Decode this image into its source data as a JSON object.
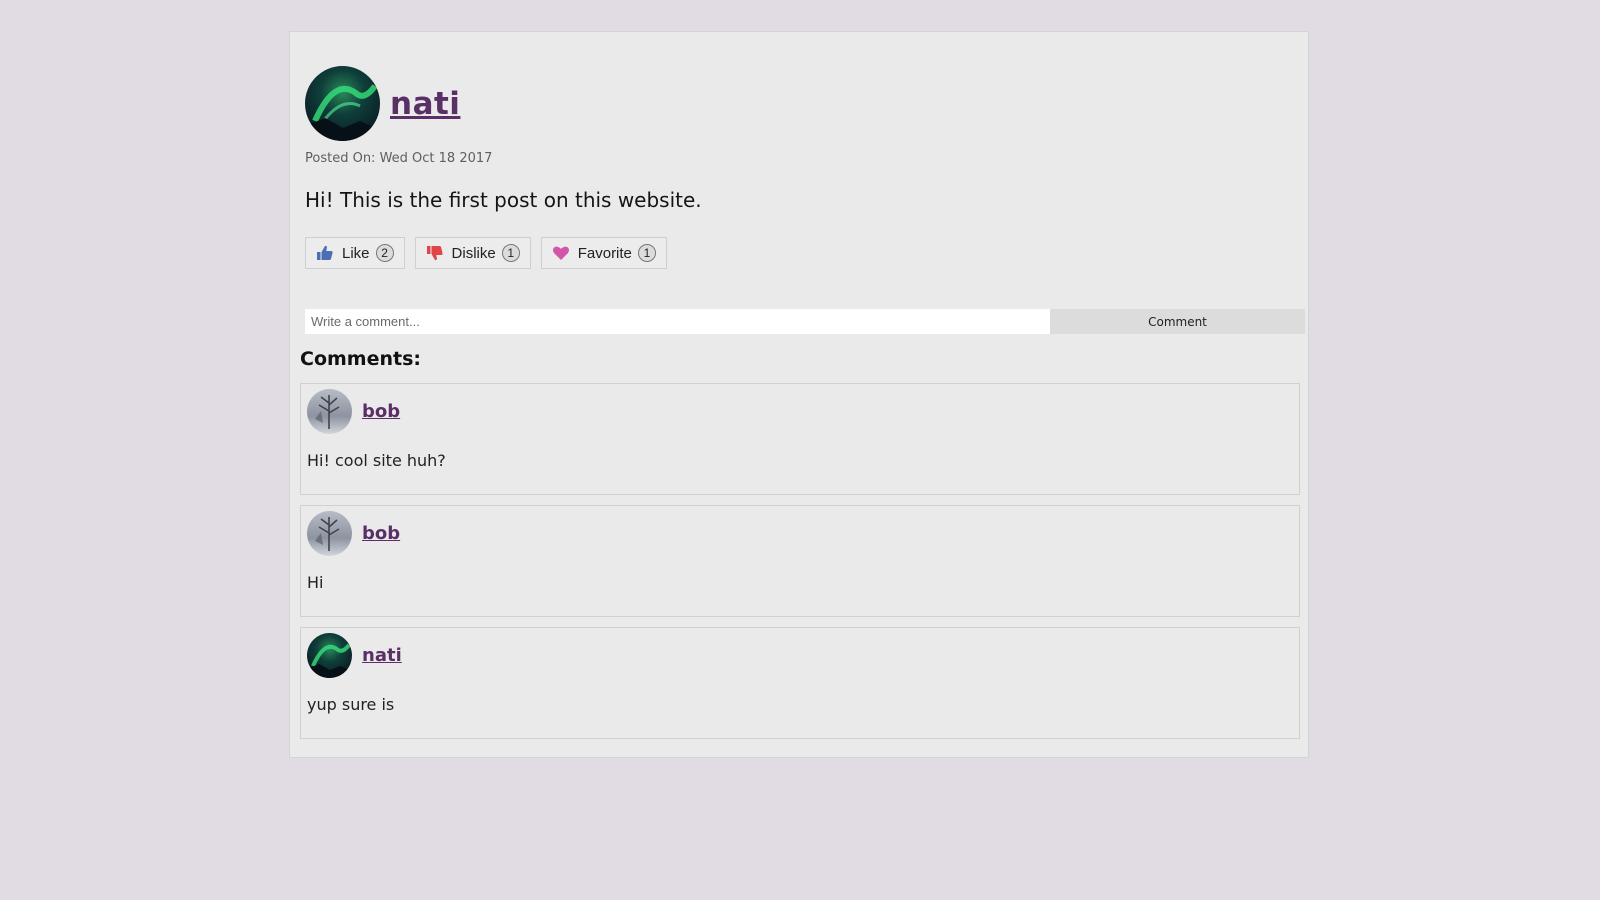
{
  "post": {
    "author": "nati",
    "posted_on": "Posted On: Wed Oct 18 2017",
    "body": "Hi! This is the first post on this website.",
    "reactions": [
      {
        "label": "Like",
        "count": "2",
        "icon": "thumbs-up-icon",
        "color": "#4a6fb5"
      },
      {
        "label": "Dislike",
        "count": "1",
        "icon": "thumbs-down-icon",
        "color": "#e04646"
      },
      {
        "label": "Favorite",
        "count": "1",
        "icon": "heart-icon",
        "color": "#d257a8"
      }
    ]
  },
  "comment_form": {
    "placeholder": "Write a comment...",
    "button_label": "Comment"
  },
  "comments_heading": "Comments:",
  "comments": [
    {
      "author": "bob",
      "text": "Hi! cool site huh?"
    },
    {
      "author": "bob",
      "text": "Hi"
    },
    {
      "author": "nati",
      "text": "yup sure is"
    }
  ],
  "colors": {
    "page_background": "#e1dce3",
    "card_background": "#eaeaea",
    "link": "#5a2f66"
  }
}
